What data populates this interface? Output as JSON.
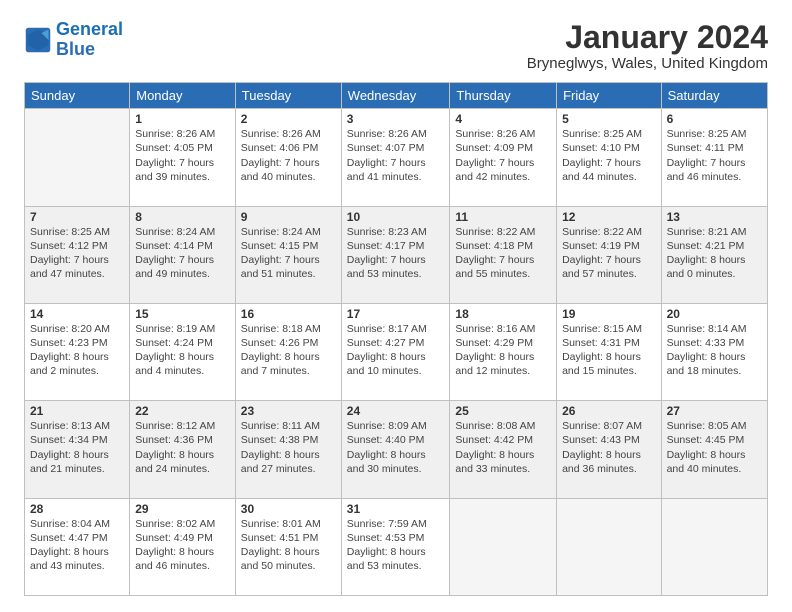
{
  "logo": {
    "line1": "General",
    "line2": "Blue"
  },
  "title": "January 2024",
  "location": "Bryneglwys, Wales, United Kingdom",
  "weekdays": [
    "Sunday",
    "Monday",
    "Tuesday",
    "Wednesday",
    "Thursday",
    "Friday",
    "Saturday"
  ],
  "weeks": [
    [
      {
        "num": "",
        "sunrise": "",
        "sunset": "",
        "daylight": "",
        "empty": true
      },
      {
        "num": "1",
        "sunrise": "Sunrise: 8:26 AM",
        "sunset": "Sunset: 4:05 PM",
        "daylight": "Daylight: 7 hours and 39 minutes."
      },
      {
        "num": "2",
        "sunrise": "Sunrise: 8:26 AM",
        "sunset": "Sunset: 4:06 PM",
        "daylight": "Daylight: 7 hours and 40 minutes."
      },
      {
        "num": "3",
        "sunrise": "Sunrise: 8:26 AM",
        "sunset": "Sunset: 4:07 PM",
        "daylight": "Daylight: 7 hours and 41 minutes."
      },
      {
        "num": "4",
        "sunrise": "Sunrise: 8:26 AM",
        "sunset": "Sunset: 4:09 PM",
        "daylight": "Daylight: 7 hours and 42 minutes."
      },
      {
        "num": "5",
        "sunrise": "Sunrise: 8:25 AM",
        "sunset": "Sunset: 4:10 PM",
        "daylight": "Daylight: 7 hours and 44 minutes."
      },
      {
        "num": "6",
        "sunrise": "Sunrise: 8:25 AM",
        "sunset": "Sunset: 4:11 PM",
        "daylight": "Daylight: 7 hours and 46 minutes."
      }
    ],
    [
      {
        "num": "7",
        "sunrise": "Sunrise: 8:25 AM",
        "sunset": "Sunset: 4:12 PM",
        "daylight": "Daylight: 7 hours and 47 minutes."
      },
      {
        "num": "8",
        "sunrise": "Sunrise: 8:24 AM",
        "sunset": "Sunset: 4:14 PM",
        "daylight": "Daylight: 7 hours and 49 minutes."
      },
      {
        "num": "9",
        "sunrise": "Sunrise: 8:24 AM",
        "sunset": "Sunset: 4:15 PM",
        "daylight": "Daylight: 7 hours and 51 minutes."
      },
      {
        "num": "10",
        "sunrise": "Sunrise: 8:23 AM",
        "sunset": "Sunset: 4:17 PM",
        "daylight": "Daylight: 7 hours and 53 minutes."
      },
      {
        "num": "11",
        "sunrise": "Sunrise: 8:22 AM",
        "sunset": "Sunset: 4:18 PM",
        "daylight": "Daylight: 7 hours and 55 minutes."
      },
      {
        "num": "12",
        "sunrise": "Sunrise: 8:22 AM",
        "sunset": "Sunset: 4:19 PM",
        "daylight": "Daylight: 7 hours and 57 minutes."
      },
      {
        "num": "13",
        "sunrise": "Sunrise: 8:21 AM",
        "sunset": "Sunset: 4:21 PM",
        "daylight": "Daylight: 8 hours and 0 minutes."
      }
    ],
    [
      {
        "num": "14",
        "sunrise": "Sunrise: 8:20 AM",
        "sunset": "Sunset: 4:23 PM",
        "daylight": "Daylight: 8 hours and 2 minutes."
      },
      {
        "num": "15",
        "sunrise": "Sunrise: 8:19 AM",
        "sunset": "Sunset: 4:24 PM",
        "daylight": "Daylight: 8 hours and 4 minutes."
      },
      {
        "num": "16",
        "sunrise": "Sunrise: 8:18 AM",
        "sunset": "Sunset: 4:26 PM",
        "daylight": "Daylight: 8 hours and 7 minutes."
      },
      {
        "num": "17",
        "sunrise": "Sunrise: 8:17 AM",
        "sunset": "Sunset: 4:27 PM",
        "daylight": "Daylight: 8 hours and 10 minutes."
      },
      {
        "num": "18",
        "sunrise": "Sunrise: 8:16 AM",
        "sunset": "Sunset: 4:29 PM",
        "daylight": "Daylight: 8 hours and 12 minutes."
      },
      {
        "num": "19",
        "sunrise": "Sunrise: 8:15 AM",
        "sunset": "Sunset: 4:31 PM",
        "daylight": "Daylight: 8 hours and 15 minutes."
      },
      {
        "num": "20",
        "sunrise": "Sunrise: 8:14 AM",
        "sunset": "Sunset: 4:33 PM",
        "daylight": "Daylight: 8 hours and 18 minutes."
      }
    ],
    [
      {
        "num": "21",
        "sunrise": "Sunrise: 8:13 AM",
        "sunset": "Sunset: 4:34 PM",
        "daylight": "Daylight: 8 hours and 21 minutes."
      },
      {
        "num": "22",
        "sunrise": "Sunrise: 8:12 AM",
        "sunset": "Sunset: 4:36 PM",
        "daylight": "Daylight: 8 hours and 24 minutes."
      },
      {
        "num": "23",
        "sunrise": "Sunrise: 8:11 AM",
        "sunset": "Sunset: 4:38 PM",
        "daylight": "Daylight: 8 hours and 27 minutes."
      },
      {
        "num": "24",
        "sunrise": "Sunrise: 8:09 AM",
        "sunset": "Sunset: 4:40 PM",
        "daylight": "Daylight: 8 hours and 30 minutes."
      },
      {
        "num": "25",
        "sunrise": "Sunrise: 8:08 AM",
        "sunset": "Sunset: 4:42 PM",
        "daylight": "Daylight: 8 hours and 33 minutes."
      },
      {
        "num": "26",
        "sunrise": "Sunrise: 8:07 AM",
        "sunset": "Sunset: 4:43 PM",
        "daylight": "Daylight: 8 hours and 36 minutes."
      },
      {
        "num": "27",
        "sunrise": "Sunrise: 8:05 AM",
        "sunset": "Sunset: 4:45 PM",
        "daylight": "Daylight: 8 hours and 40 minutes."
      }
    ],
    [
      {
        "num": "28",
        "sunrise": "Sunrise: 8:04 AM",
        "sunset": "Sunset: 4:47 PM",
        "daylight": "Daylight: 8 hours and 43 minutes."
      },
      {
        "num": "29",
        "sunrise": "Sunrise: 8:02 AM",
        "sunset": "Sunset: 4:49 PM",
        "daylight": "Daylight: 8 hours and 46 minutes."
      },
      {
        "num": "30",
        "sunrise": "Sunrise: 8:01 AM",
        "sunset": "Sunset: 4:51 PM",
        "daylight": "Daylight: 8 hours and 50 minutes."
      },
      {
        "num": "31",
        "sunrise": "Sunrise: 7:59 AM",
        "sunset": "Sunset: 4:53 PM",
        "daylight": "Daylight: 8 hours and 53 minutes."
      },
      {
        "num": "",
        "sunrise": "",
        "sunset": "",
        "daylight": "",
        "empty": true
      },
      {
        "num": "",
        "sunrise": "",
        "sunset": "",
        "daylight": "",
        "empty": true
      },
      {
        "num": "",
        "sunrise": "",
        "sunset": "",
        "daylight": "",
        "empty": true
      }
    ]
  ]
}
